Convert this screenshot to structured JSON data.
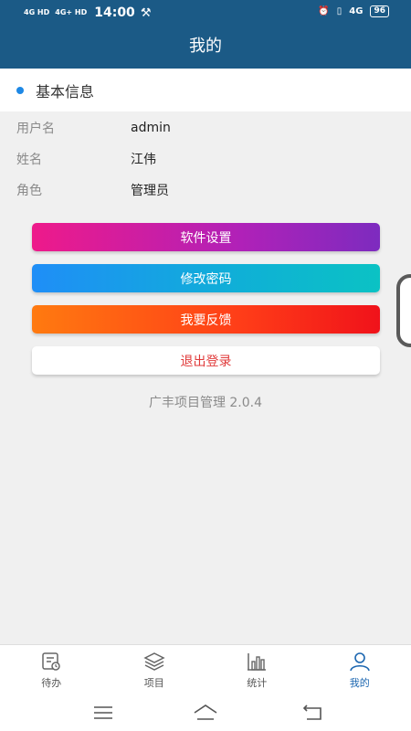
{
  "status_bar": {
    "network_left_1": "4G HD",
    "network_left_2": "4G+ HD",
    "time": "14:00",
    "network_right": "4G",
    "battery": "96"
  },
  "header": {
    "title": "我的"
  },
  "section": {
    "title": "基本信息"
  },
  "profile": {
    "rows": [
      {
        "label": "用户名",
        "value": "admin"
      },
      {
        "label": "姓名",
        "value": "江伟"
      },
      {
        "label": "角色",
        "value": "管理员"
      }
    ]
  },
  "actions": {
    "settings": "软件设置",
    "password": "修改密码",
    "feedback": "我要反馈",
    "logout": "退出登录"
  },
  "version_text": "广丰项目管理 2.0.4",
  "tabs": [
    {
      "label": "待办",
      "icon": "todo-icon"
    },
    {
      "label": "项目",
      "icon": "layers-icon"
    },
    {
      "label": "统计",
      "icon": "bar-chart-icon"
    },
    {
      "label": "我的",
      "icon": "user-icon",
      "active": true
    }
  ],
  "colors": {
    "header_bg": "#1b5a86",
    "accent": "#1b66b0",
    "logout_text": "#e03a3a"
  }
}
